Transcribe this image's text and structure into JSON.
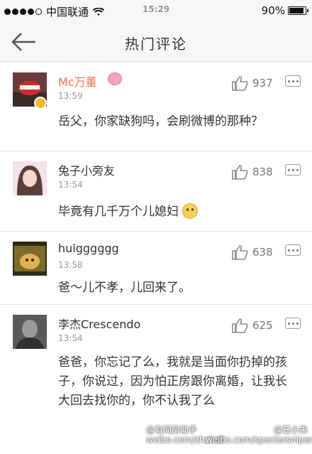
{
  "status_bar": {
    "carrier": "中国联通",
    "time": "15:29",
    "battery": "90%",
    "battery_level": 0.9
  },
  "nav": {
    "title": "热门评论",
    "back_icon": "arrow-left-icon"
  },
  "comments": [
    {
      "username": "Mc万董",
      "time": "13:59",
      "likes": "937",
      "text": "岳父，你家缺狗吗，会刷微博的那种？"
    },
    {
      "username": "兔子小旁友",
      "time": "13:54",
      "likes": "838",
      "text": "毕竟有几千万个儿媳妇"
    },
    {
      "username": "huigggggg",
      "time": "13:58",
      "likes": "638",
      "text": "爸～儿不孝，儿回来了。"
    },
    {
      "username": "李杰Crescendo",
      "time": "13:54",
      "likes": "625",
      "text": "爸爸，你忘记了么，我就是当面你扔掉的孩子，你说过，因为怕正房跟你离婚，让我长大回去找你的，你不认我了么"
    }
  ],
  "watermarks": {
    "w1": "@有间房助手",
    "w2": "@石小朱",
    "w3": "weibo.com/zhzheli",
    "w4": "weibo.com/spectersniper"
  },
  "colors": {
    "vip_name": "#eb7350",
    "background": "#f5f5f5"
  }
}
